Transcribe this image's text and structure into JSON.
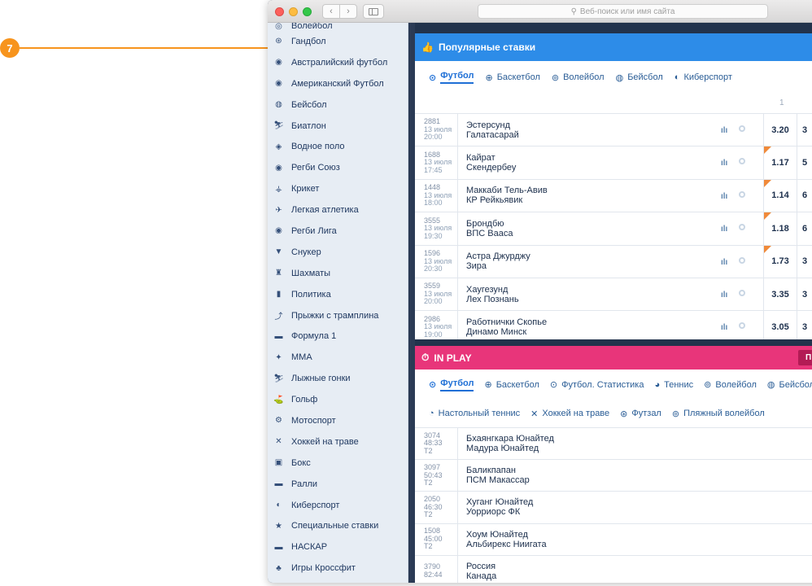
{
  "callout": {
    "number": "7"
  },
  "browser": {
    "address_placeholder": "Веб-поиск или имя сайта",
    "search_glyph": "⚲",
    "back_glyph": "‹",
    "forward_glyph": "›"
  },
  "sidebar": {
    "items": [
      {
        "label": "Волейбол",
        "icon": "◎"
      },
      {
        "label": "Гандбол",
        "icon": "⊛"
      },
      {
        "label": "Австралийский футбол",
        "icon": "◉"
      },
      {
        "label": "Американский Футбол",
        "icon": "◉"
      },
      {
        "label": "Бейсбол",
        "icon": "◍"
      },
      {
        "label": "Биатлон",
        "icon": "⛷"
      },
      {
        "label": "Водное поло",
        "icon": "◈"
      },
      {
        "label": "Регби Союз",
        "icon": "◉"
      },
      {
        "label": "Крикет",
        "icon": "⚶"
      },
      {
        "label": "Легкая атлетика",
        "icon": "✈"
      },
      {
        "label": "Регби Лига",
        "icon": "◉"
      },
      {
        "label": "Снукер",
        "icon": "▼"
      },
      {
        "label": "Шахматы",
        "icon": "♜"
      },
      {
        "label": "Политика",
        "icon": "▮"
      },
      {
        "label": "Прыжки с трамплина",
        "icon": "⤴"
      },
      {
        "label": "Формула 1",
        "icon": "▬"
      },
      {
        "label": "MMA",
        "icon": "✦"
      },
      {
        "label": "Лыжные гонки",
        "icon": "⛷"
      },
      {
        "label": "Гольф",
        "icon": "⛳"
      },
      {
        "label": "Мотоспорт",
        "icon": "⚙"
      },
      {
        "label": "Хоккей на траве",
        "icon": "✕"
      },
      {
        "label": "Бокс",
        "icon": "▣"
      },
      {
        "label": "Ралли",
        "icon": "▬"
      },
      {
        "label": "Киберспорт",
        "icon": "◐"
      },
      {
        "label": "Специальные ставки",
        "icon": "★"
      },
      {
        "label": "НАСКАР",
        "icon": "▬"
      },
      {
        "label": "Игры Кроссфит",
        "icon": "♣"
      }
    ]
  },
  "popular": {
    "title": "Популярные ставки",
    "title_icon": "👍",
    "tabs": [
      {
        "label": "Футбол",
        "icon": "⊙"
      },
      {
        "label": "Баскетбол",
        "icon": "⊕"
      },
      {
        "label": "Волейбол",
        "icon": "⊚"
      },
      {
        "label": "Бейсбол",
        "icon": "◍"
      },
      {
        "label": "Киберспорт",
        "icon": "◐"
      }
    ],
    "column_header": "1",
    "stats_glyph": "ılı",
    "matches": [
      {
        "id": "2881",
        "date": "13 июля",
        "time": "20:00",
        "home": "Эстерсунд",
        "away": "Галатасарай",
        "odd1": "3.20",
        "next": "3",
        "flag": false
      },
      {
        "id": "1688",
        "date": "13 июля",
        "time": "17:45",
        "home": "Кайрат",
        "away": "Скендербеу",
        "odd1": "1.17",
        "next": "5",
        "flag": true
      },
      {
        "id": "1448",
        "date": "13 июля",
        "time": "18:00",
        "home": "Маккаби Тель-Авив",
        "away": "КР Рейкьявик",
        "odd1": "1.14",
        "next": "6",
        "flag": true
      },
      {
        "id": "3555",
        "date": "13 июля",
        "time": "19:30",
        "home": "Брондбю",
        "away": "ВПС Вааса",
        "odd1": "1.18",
        "next": "6",
        "flag": true
      },
      {
        "id": "1596",
        "date": "13 июля",
        "time": "20:30",
        "home": "Астра Джурджу",
        "away": "Зира",
        "odd1": "1.73",
        "next": "3",
        "flag": true
      },
      {
        "id": "3559",
        "date": "13 июля",
        "time": "20:00",
        "home": "Хаугезунд",
        "away": "Лех Познань",
        "odd1": "3.35",
        "next": "3",
        "flag": false
      },
      {
        "id": "2986",
        "date": "13 июля",
        "time": "19:00",
        "home": "Работнички Скопье",
        "away": "Динамо Минск",
        "odd1": "3.05",
        "next": "3",
        "flag": false
      }
    ]
  },
  "inplay": {
    "title": "IN PLAY",
    "title_icon": "⏱",
    "button_label": "П",
    "tabs_row1": [
      {
        "label": "Футбол",
        "icon": "⊙"
      },
      {
        "label": "Баскетбол",
        "icon": "⊕"
      },
      {
        "label": "Футбол. Статистика",
        "icon": "⊙"
      },
      {
        "label": "Теннис",
        "icon": "◕"
      },
      {
        "label": "Волейбол",
        "icon": "⊚"
      },
      {
        "label": "Бейсбол",
        "icon": "◍"
      }
    ],
    "tabs_row2": [
      {
        "label": "Настольный теннис",
        "icon": "◔"
      },
      {
        "label": "Хоккей на траве",
        "icon": "✕"
      },
      {
        "label": "Футзал",
        "icon": "⊛"
      },
      {
        "label": "Пляжный волейбол",
        "icon": "⊚"
      }
    ],
    "matches": [
      {
        "id": "3074",
        "clock": "48:33",
        "period": "T2",
        "home": "Бхаянгкара Юнайтед",
        "away": "Мадура Юнайтед"
      },
      {
        "id": "3097",
        "clock": "50:43",
        "period": "T2",
        "home": "Баликпапан",
        "away": "ПСМ Макассар"
      },
      {
        "id": "2050",
        "clock": "46:30",
        "period": "T2",
        "home": "Хуганг Юнайтед",
        "away": "Уорриорс ФК"
      },
      {
        "id": "1508",
        "clock": "45:00",
        "period": "T2",
        "home": "Хоум Юнайтед",
        "away": "Альбирекс Ниигата"
      },
      {
        "id": "3790",
        "clock": "82:44",
        "period": "",
        "home": "Россия",
        "away": "Канада"
      }
    ]
  },
  "colors": {
    "popular_header": "#2d8ce8",
    "inplay_header": "#e8357a",
    "callout": "#f7941d",
    "odds_flag": "#f08a3a"
  }
}
